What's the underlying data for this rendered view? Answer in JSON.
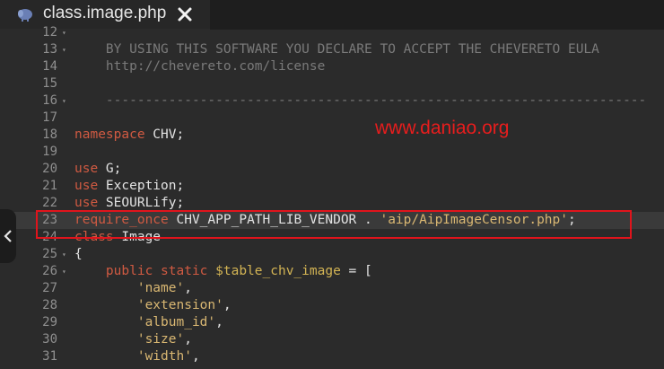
{
  "tab": {
    "title": "class.image.php",
    "icon": "elephant-icon",
    "close_icon": "close-icon"
  },
  "watermark": "www.daniao.org",
  "colors": {
    "keyword": "#d05a42",
    "variable": "#d3b454",
    "string": "#d9b772",
    "comment": "#7a7a7a",
    "highlight_border": "#e0141c"
  },
  "lines": [
    {
      "n": "12",
      "t": ""
    },
    {
      "n": "13",
      "t": "    BY USING THIS SOFTWARE YOU DECLARE TO ACCEPT THE CHEVERETO EULA"
    },
    {
      "n": "14",
      "t": "    http://chevereto.com/license"
    },
    {
      "n": "15",
      "t": ""
    },
    {
      "n": "16",
      "t": "    ---------------------------------------------------------------------"
    },
    {
      "n": "17",
      "t": ""
    },
    {
      "n": "18",
      "kw": "namespace",
      "rest": " CHV;"
    },
    {
      "n": "19",
      "t": ""
    },
    {
      "n": "20",
      "kw": "use",
      "rest": " G;"
    },
    {
      "n": "21",
      "kw": "use",
      "rest": " Exception;"
    },
    {
      "n": "22",
      "kw": "use",
      "rest": " SEOURLify;"
    },
    {
      "n": "23",
      "kw": "require_once",
      "rest": " CHV_APP_PATH_LIB_VENDOR . ",
      "str": "'aip/AipImageCensor.php'",
      "end": ";"
    },
    {
      "n": "24",
      "kw": "class",
      "rest": " Image"
    },
    {
      "n": "25",
      "t": "{"
    },
    {
      "n": "26",
      "kw": "    public static",
      "var": " $table_chv_image",
      "rest": " = ["
    },
    {
      "n": "27",
      "str": "        'name'",
      "end": ","
    },
    {
      "n": "28",
      "str": "        'extension'",
      "end": ","
    },
    {
      "n": "29",
      "str": "        'album_id'",
      "end": ","
    },
    {
      "n": "30",
      "str": "        'size'",
      "end": ","
    },
    {
      "n": "31",
      "str": "        'width'",
      "end": ","
    }
  ]
}
